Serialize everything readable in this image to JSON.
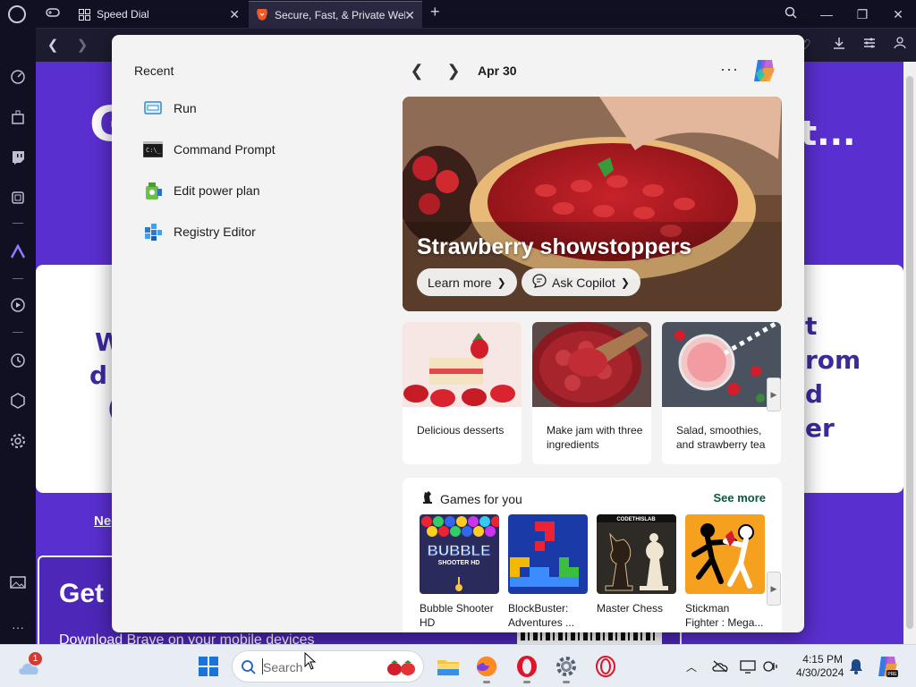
{
  "browser": {
    "tabs": [
      {
        "label": "Speed Dial",
        "active": false
      },
      {
        "label": "Secure, Fast, & Private Web",
        "active": true
      }
    ],
    "new_tab": "+",
    "close_glyph": "✕"
  },
  "webpage": {
    "headline_left": "G",
    "headline_right": "t...",
    "card_left": [
      "W",
      "d",
      "("
    ],
    "card_right": [
      "t",
      "rom",
      "d",
      "er"
    ],
    "new_link": "Ne",
    "get_title": "Get c",
    "get_sub": "Download Brave on your mobile devices"
  },
  "widgets": {
    "recent_heading": "Recent",
    "recent_items": [
      {
        "label": "Run",
        "icon": "run-icon"
      },
      {
        "label": "Command Prompt",
        "icon": "command-prompt-icon"
      },
      {
        "label": "Edit power plan",
        "icon": "power-plan-icon"
      },
      {
        "label": "Registry Editor",
        "icon": "registry-editor-icon"
      }
    ],
    "date": "Apr 30",
    "more": "···",
    "hero": {
      "title": "Strawberry showstoppers",
      "learn_more": "Learn more",
      "ask_copilot": "Ask Copilot"
    },
    "tiles": [
      {
        "caption": "Delicious desserts"
      },
      {
        "caption": "Make jam with three ingredients"
      },
      {
        "caption": "Salad, smoothies, and strawberry tea"
      }
    ],
    "games": {
      "heading": "Games for you",
      "see_more": "See more",
      "items": [
        {
          "name": "Bubble Shooter HD",
          "logo_text": "BUBBLE",
          "logo_sub": "SHOOTER HD"
        },
        {
          "name": "BlockBuster: Adventures ..."
        },
        {
          "name": "Master Chess",
          "logo_text": "CODETHISLAB"
        },
        {
          "name": "Stickman Fighter : Mega..."
        }
      ]
    }
  },
  "taskbar": {
    "search_placeholder": "Search",
    "time": "4:15 PM",
    "date": "4/30/2024",
    "notification_count": "1"
  }
}
